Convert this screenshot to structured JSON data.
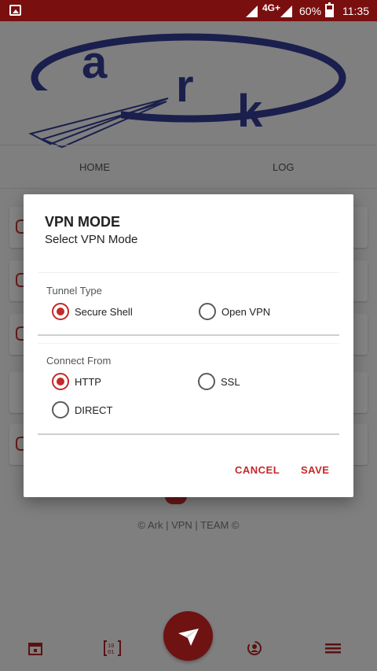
{
  "status_bar": {
    "network": "4G+",
    "battery": "60%",
    "time": "11:35"
  },
  "app": {
    "logo_text": "ark",
    "tabs": [
      {
        "label": "HOME"
      },
      {
        "label": "LOG"
      }
    ],
    "footer": "© Ark | VPN | TEAM ©"
  },
  "dialog": {
    "title": "VPN MODE",
    "subtitle": "Select VPN Mode",
    "tunnel_type": {
      "label": "Tunnel Type",
      "options": [
        {
          "label": "Secure Shell",
          "checked": true
        },
        {
          "label": "Open VPN",
          "checked": false
        }
      ]
    },
    "connect_from": {
      "label": "Connect From",
      "options": [
        {
          "label": "HTTP",
          "checked": true
        },
        {
          "label": "SSL",
          "checked": false
        },
        {
          "label": "DIRECT",
          "checked": false
        }
      ]
    },
    "cancel_label": "CANCEL",
    "save_label": "SAVE"
  },
  "colors": {
    "accent": "#c62828",
    "statusbar": "#7a0f0f",
    "scrim_bg": "#7f7f7f",
    "logo_ring": "#1a1f4d"
  },
  "bottom_nav": {
    "icons": [
      "calendar-icon",
      "binary-icon",
      "send-icon",
      "refresh-user-icon",
      "menu-icon"
    ]
  }
}
